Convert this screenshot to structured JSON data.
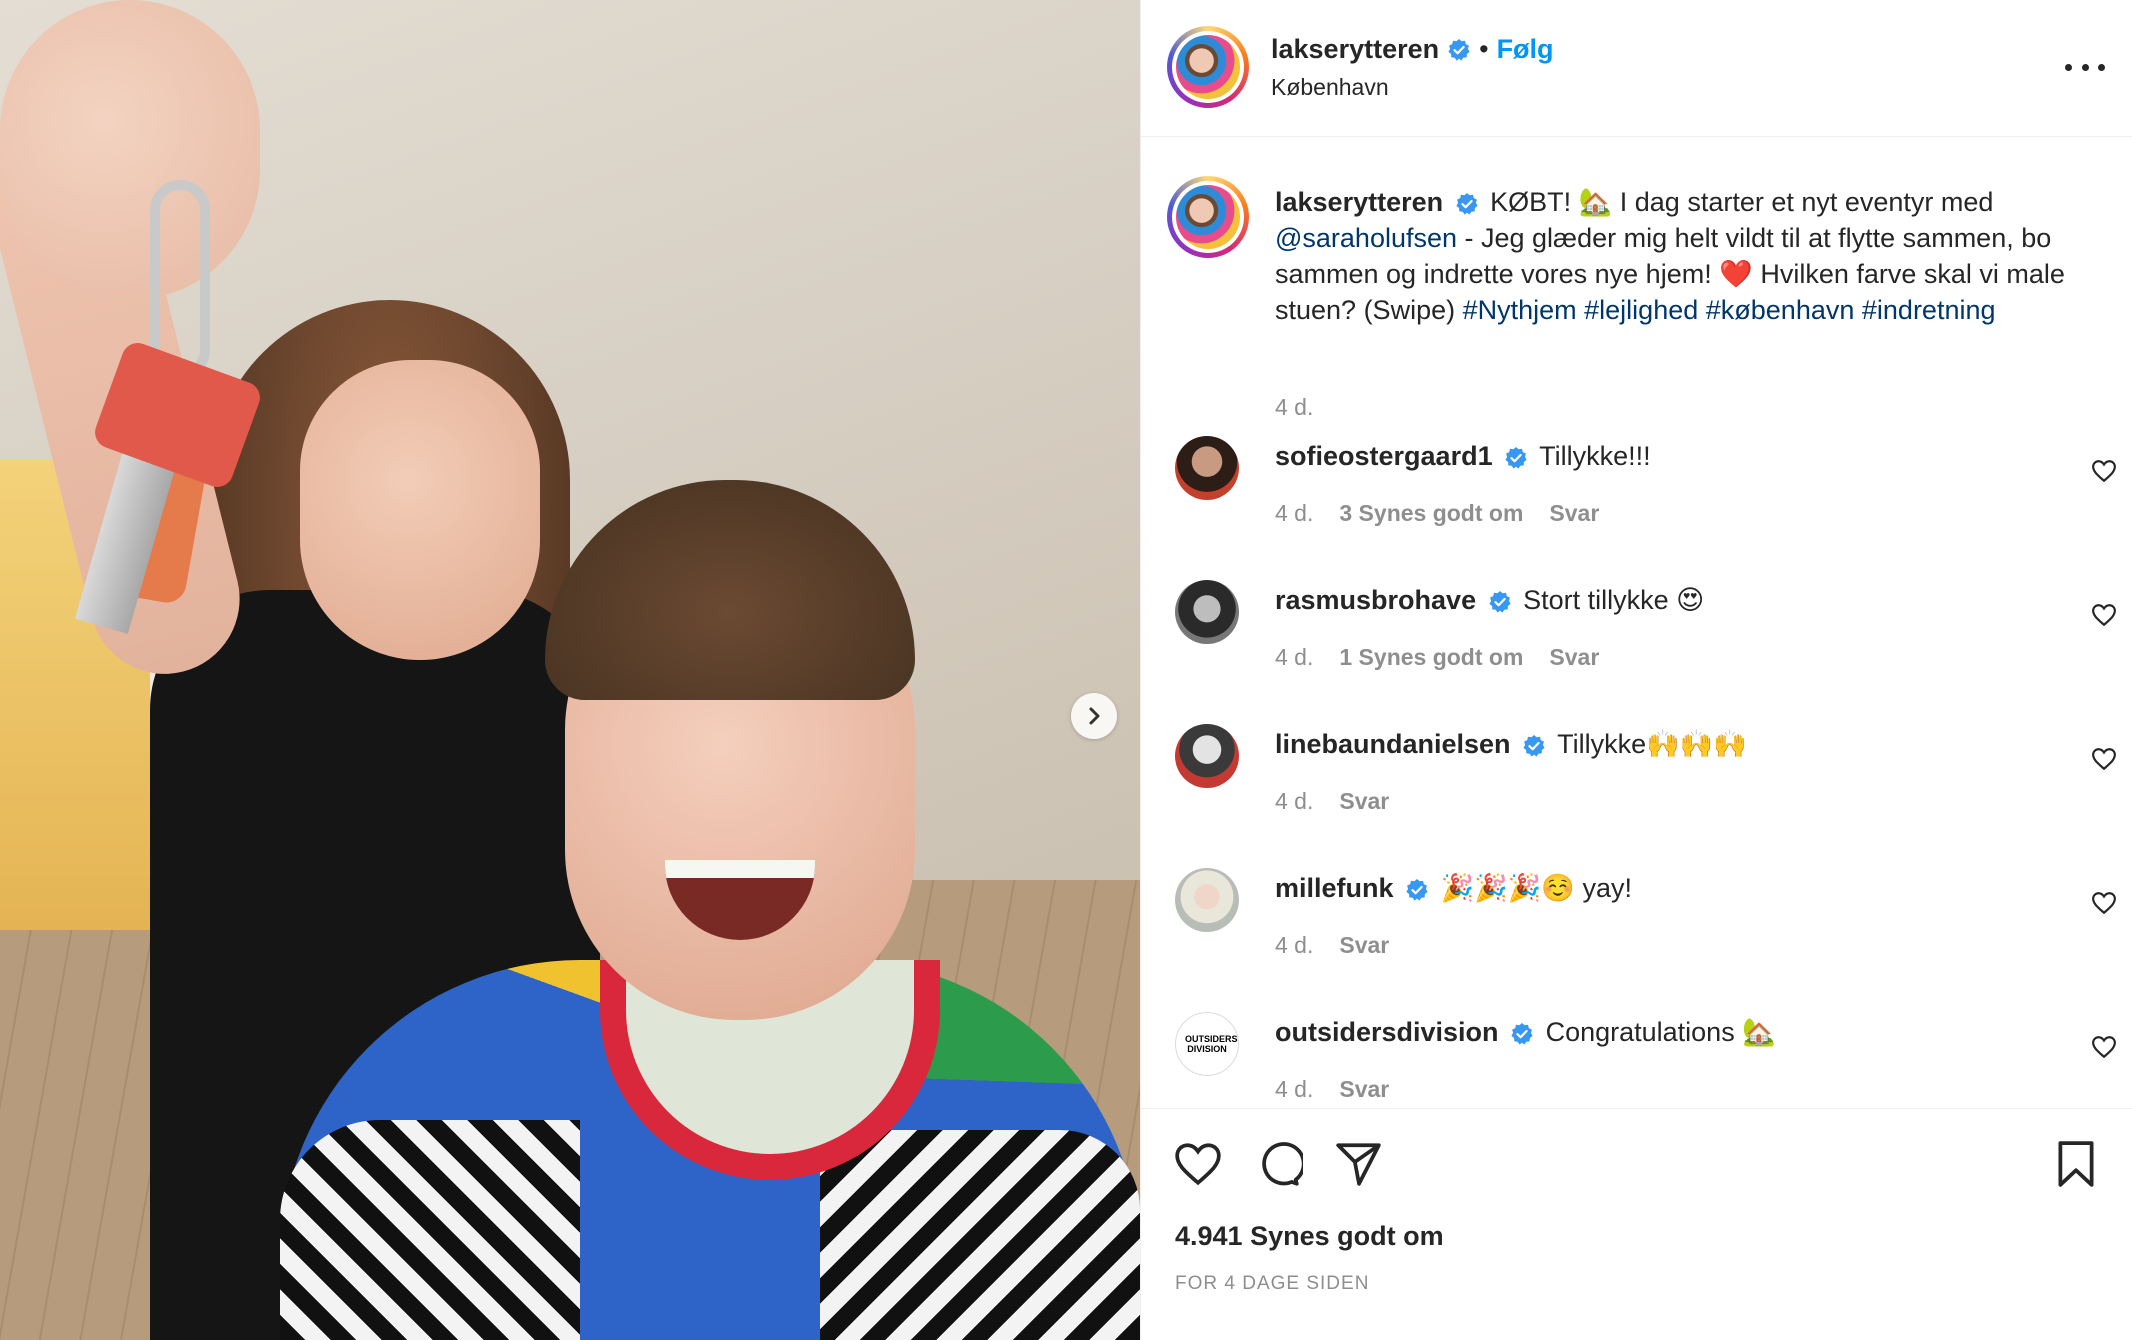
{
  "post": {
    "username": "lakserytteren",
    "follow_label": "Følg",
    "dot": "•",
    "location": "København"
  },
  "caption": {
    "username": "lakserytteren",
    "part1": "KØBT! 🏡 I dag starter et nyt eventyr med ",
    "mention": "@saraholufsen",
    "part2": " - Jeg glæder mig helt vildt til at flytte sammen, bo sammen og indrette vores nye hjem! ❤️ Hvilken farve skal vi male stuen? (Swipe) ",
    "hashtags": [
      "#Nythjem",
      "#lejlighed",
      "#københavn",
      "#indretning"
    ],
    "time": "4 d."
  },
  "comments": [
    {
      "username": "sofieostergaard1",
      "text": "Tillykke!!!",
      "time": "4 d.",
      "likes": "3 Synes godt om",
      "reply": "Svar",
      "avatar_color": "#3a2a22"
    },
    {
      "username": "rasmusbrohave",
      "text": "Stort tillykke 😍",
      "time": "4 d.",
      "likes": "1 Synes godt om",
      "reply": "Svar",
      "avatar_color": "#4a4a4a"
    },
    {
      "username": "linebaundanielsen",
      "text": "Tillykke🙌🙌🙌",
      "time": "4 d.",
      "likes": "",
      "reply": "Svar",
      "avatar_color": "#5b5b5b"
    },
    {
      "username": "millefunk",
      "text": "🎉🎉🎉☺️ yay!",
      "time": "4 d.",
      "likes": "",
      "reply": "Svar",
      "avatar_color": "#c9cbc6"
    },
    {
      "username": "outsidersdivision",
      "text": "Congratulations 🏡",
      "time": "4 d.",
      "likes": "",
      "reply": "Svar",
      "avatar_color": "#ffffff",
      "avatar_text": "OUTSIDERS DIVISION"
    }
  ],
  "footer": {
    "likes": "4.941 Synes godt om",
    "date": "FOR 4 DAGE SIDEN"
  },
  "icons": {
    "verified": "verified-badge-icon",
    "more": "more-options-icon",
    "next": "chevron-right-icon",
    "like": "heart-icon",
    "comment": "comment-icon",
    "share": "share-icon",
    "save": "bookmark-icon"
  },
  "colors": {
    "accent": "#0095f6",
    "link": "#00376b",
    "muted": "#8e8e8e",
    "verified": "#3897f0"
  }
}
